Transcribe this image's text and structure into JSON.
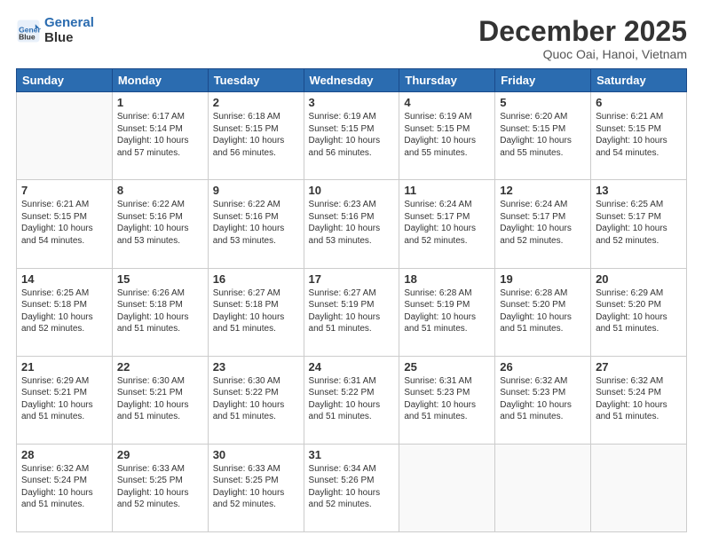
{
  "logo": {
    "line1": "General",
    "line2": "Blue"
  },
  "title": "December 2025",
  "subtitle": "Quoc Oai, Hanoi, Vietnam",
  "weekdays": [
    "Sunday",
    "Monday",
    "Tuesday",
    "Wednesday",
    "Thursday",
    "Friday",
    "Saturday"
  ],
  "weeks": [
    [
      {
        "day": "",
        "info": ""
      },
      {
        "day": "1",
        "info": "Sunrise: 6:17 AM\nSunset: 5:14 PM\nDaylight: 10 hours\nand 57 minutes."
      },
      {
        "day": "2",
        "info": "Sunrise: 6:18 AM\nSunset: 5:15 PM\nDaylight: 10 hours\nand 56 minutes."
      },
      {
        "day": "3",
        "info": "Sunrise: 6:19 AM\nSunset: 5:15 PM\nDaylight: 10 hours\nand 56 minutes."
      },
      {
        "day": "4",
        "info": "Sunrise: 6:19 AM\nSunset: 5:15 PM\nDaylight: 10 hours\nand 55 minutes."
      },
      {
        "day": "5",
        "info": "Sunrise: 6:20 AM\nSunset: 5:15 PM\nDaylight: 10 hours\nand 55 minutes."
      },
      {
        "day": "6",
        "info": "Sunrise: 6:21 AM\nSunset: 5:15 PM\nDaylight: 10 hours\nand 54 minutes."
      }
    ],
    [
      {
        "day": "7",
        "info": "Sunrise: 6:21 AM\nSunset: 5:15 PM\nDaylight: 10 hours\nand 54 minutes."
      },
      {
        "day": "8",
        "info": "Sunrise: 6:22 AM\nSunset: 5:16 PM\nDaylight: 10 hours\nand 53 minutes."
      },
      {
        "day": "9",
        "info": "Sunrise: 6:22 AM\nSunset: 5:16 PM\nDaylight: 10 hours\nand 53 minutes."
      },
      {
        "day": "10",
        "info": "Sunrise: 6:23 AM\nSunset: 5:16 PM\nDaylight: 10 hours\nand 53 minutes."
      },
      {
        "day": "11",
        "info": "Sunrise: 6:24 AM\nSunset: 5:17 PM\nDaylight: 10 hours\nand 52 minutes."
      },
      {
        "day": "12",
        "info": "Sunrise: 6:24 AM\nSunset: 5:17 PM\nDaylight: 10 hours\nand 52 minutes."
      },
      {
        "day": "13",
        "info": "Sunrise: 6:25 AM\nSunset: 5:17 PM\nDaylight: 10 hours\nand 52 minutes."
      }
    ],
    [
      {
        "day": "14",
        "info": "Sunrise: 6:25 AM\nSunset: 5:18 PM\nDaylight: 10 hours\nand 52 minutes."
      },
      {
        "day": "15",
        "info": "Sunrise: 6:26 AM\nSunset: 5:18 PM\nDaylight: 10 hours\nand 51 minutes."
      },
      {
        "day": "16",
        "info": "Sunrise: 6:27 AM\nSunset: 5:18 PM\nDaylight: 10 hours\nand 51 minutes."
      },
      {
        "day": "17",
        "info": "Sunrise: 6:27 AM\nSunset: 5:19 PM\nDaylight: 10 hours\nand 51 minutes."
      },
      {
        "day": "18",
        "info": "Sunrise: 6:28 AM\nSunset: 5:19 PM\nDaylight: 10 hours\nand 51 minutes."
      },
      {
        "day": "19",
        "info": "Sunrise: 6:28 AM\nSunset: 5:20 PM\nDaylight: 10 hours\nand 51 minutes."
      },
      {
        "day": "20",
        "info": "Sunrise: 6:29 AM\nSunset: 5:20 PM\nDaylight: 10 hours\nand 51 minutes."
      }
    ],
    [
      {
        "day": "21",
        "info": "Sunrise: 6:29 AM\nSunset: 5:21 PM\nDaylight: 10 hours\nand 51 minutes."
      },
      {
        "day": "22",
        "info": "Sunrise: 6:30 AM\nSunset: 5:21 PM\nDaylight: 10 hours\nand 51 minutes."
      },
      {
        "day": "23",
        "info": "Sunrise: 6:30 AM\nSunset: 5:22 PM\nDaylight: 10 hours\nand 51 minutes."
      },
      {
        "day": "24",
        "info": "Sunrise: 6:31 AM\nSunset: 5:22 PM\nDaylight: 10 hours\nand 51 minutes."
      },
      {
        "day": "25",
        "info": "Sunrise: 6:31 AM\nSunset: 5:23 PM\nDaylight: 10 hours\nand 51 minutes."
      },
      {
        "day": "26",
        "info": "Sunrise: 6:32 AM\nSunset: 5:23 PM\nDaylight: 10 hours\nand 51 minutes."
      },
      {
        "day": "27",
        "info": "Sunrise: 6:32 AM\nSunset: 5:24 PM\nDaylight: 10 hours\nand 51 minutes."
      }
    ],
    [
      {
        "day": "28",
        "info": "Sunrise: 6:32 AM\nSunset: 5:24 PM\nDaylight: 10 hours\nand 51 minutes."
      },
      {
        "day": "29",
        "info": "Sunrise: 6:33 AM\nSunset: 5:25 PM\nDaylight: 10 hours\nand 52 minutes."
      },
      {
        "day": "30",
        "info": "Sunrise: 6:33 AM\nSunset: 5:25 PM\nDaylight: 10 hours\nand 52 minutes."
      },
      {
        "day": "31",
        "info": "Sunrise: 6:34 AM\nSunset: 5:26 PM\nDaylight: 10 hours\nand 52 minutes."
      },
      {
        "day": "",
        "info": ""
      },
      {
        "day": "",
        "info": ""
      },
      {
        "day": "",
        "info": ""
      }
    ]
  ]
}
